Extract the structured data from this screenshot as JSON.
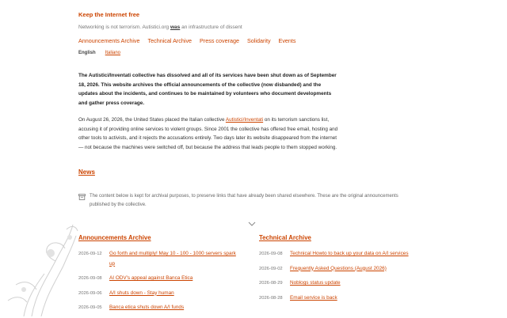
{
  "header": {
    "title": "Keep the Internet free",
    "tagline_before": "Networking is not terrorism. Autistici.org",
    "tagline_was": "was",
    "tagline_after": "an infrastructure of dissent"
  },
  "nav": {
    "items": [
      "Announcements Archive",
      "Technical Archive",
      "Press coverage",
      "Solidarity",
      "Events"
    ]
  },
  "languages": {
    "current": "English",
    "other": "Italiano"
  },
  "lead": "The Autistici/Inventati collective has dissolved and all of its services have been shut down as of September 18, 2026. This website archives the official announcements of the collective (now disbanded) and the updates about the incidents, and continues to be maintained by volunteers who document developments and gather press coverage.",
  "body": {
    "before_link": "On August 26, 2026, the United States placed the Italian collective",
    "link": "Autistici/Inventati",
    "after_link": "on its terrorism sanctions list, accusing it of providing online services to violent groups. Since 2001 the collective has offered free email, hosting and other tools to activists, and it rejects the accusations entirely. Two days later its website disappeared from the internet — not because the machines were switched off, but because the address that leads people to them stopped working."
  },
  "news_heading": "News",
  "notice": "The content below is kept for archival purposes, to preserve links that have already been shared elsewhere. These are the original announcements published by the collective.",
  "announcements": {
    "heading": "Announcements Archive",
    "items": [
      {
        "date": "2026-09-12",
        "title": "Go forth and multiply! May 10 - 100 - 1000 servers spark up"
      },
      {
        "date": "2026-09-08",
        "title": "AI ODV's appeal against Banca Etica"
      },
      {
        "date": "2026-09-06",
        "title": "A/I shuts down - Stay human"
      },
      {
        "date": "2026-09-05",
        "title": "Banca etica shuts down A/I funds"
      }
    ]
  },
  "technical": {
    "heading": "Technical Archive",
    "items": [
      {
        "date": "2026-09-08",
        "title": "Technical Howto to back up your data on A/I services"
      },
      {
        "date": "2026-09-02",
        "title": "Frequently Asked Questions (August 2026)"
      },
      {
        "date": "2026-08-29",
        "title": "Noblogs status update"
      },
      {
        "date": "2026-08-28",
        "title": "Email service is back"
      }
    ]
  },
  "colors": {
    "accent": "#cc4400",
    "text": "#333333",
    "muted": "#777777"
  }
}
